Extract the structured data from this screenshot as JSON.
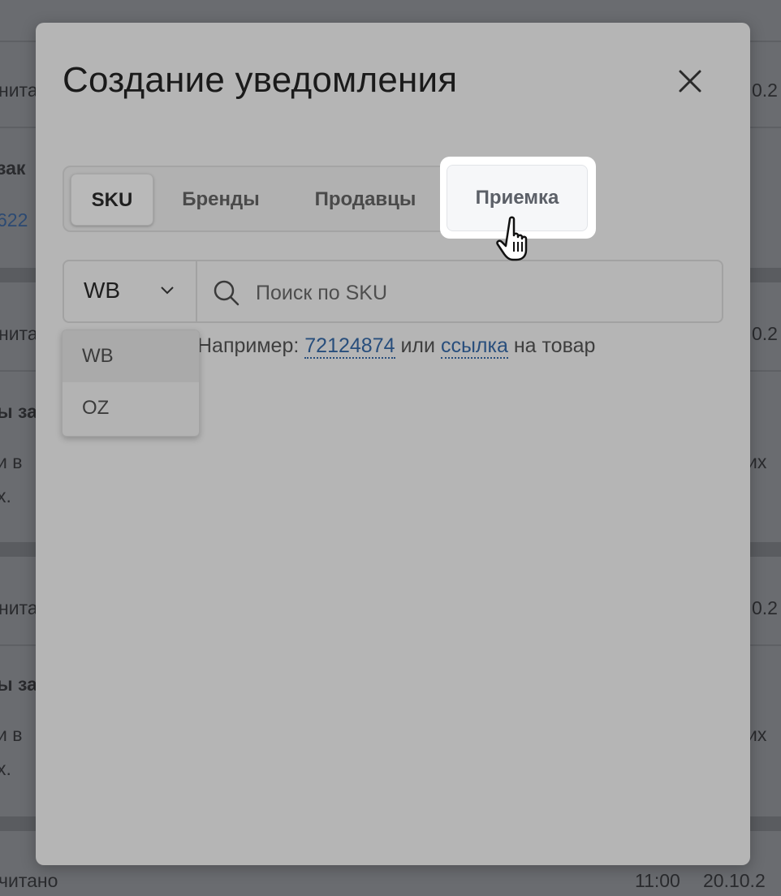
{
  "background": {
    "rows": [
      {
        "status": "нитан",
        "date": "0.2"
      },
      {
        "title": "зак",
        "link": "622"
      },
      {
        "status": "нитан",
        "date": "0.2"
      },
      {
        "title": "ы за",
        "line1": "и в",
        "line1_end": "их",
        "line2": "х."
      },
      {
        "status": "нитан",
        "date": "0.2"
      },
      {
        "title": "ы за",
        "line1": "и в",
        "line1_end": "их",
        "line2": "х."
      },
      {
        "status": "читано",
        "time": "11:00",
        "date": "20.10.2"
      }
    ]
  },
  "modal": {
    "title": "Создание уведомления",
    "close_icon": "close-icon",
    "tabs": [
      {
        "label": "SKU",
        "active": true
      },
      {
        "label": "Бренды",
        "active": false
      },
      {
        "label": "Продавцы",
        "active": false
      },
      {
        "label": "Приемка",
        "active": false,
        "hovered": true
      }
    ],
    "marketplace_select": {
      "value": "WB",
      "options": [
        "WB",
        "OZ"
      ],
      "open": true
    },
    "search": {
      "placeholder": "Поиск по SKU",
      "value": ""
    },
    "hint": {
      "prefix": "Например:",
      "example_sku": "72124874",
      "middle": "или",
      "link_text": "ссылка",
      "suffix": "на товар"
    }
  },
  "colors": {
    "link": "#284e7c",
    "modal_bg": "#b5b5b5",
    "page_bg": "#6a6c70"
  }
}
